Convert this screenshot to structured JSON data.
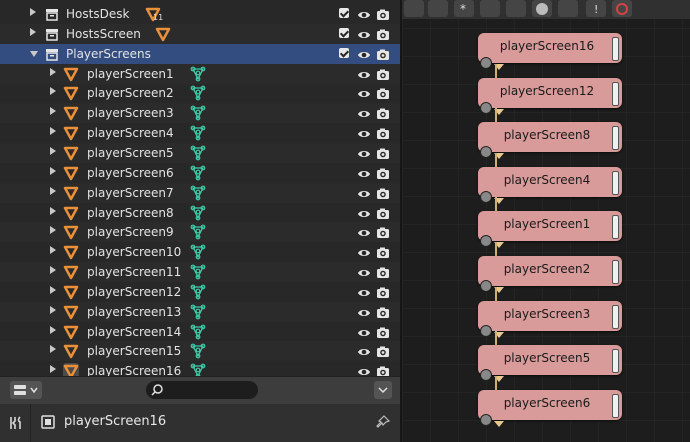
{
  "outliner": {
    "rows": [
      {
        "label": "HostsDesk",
        "kind": "collection",
        "expanded": false,
        "extra": "mesh-count",
        "extra_text": "11"
      },
      {
        "label": "HostsScreen",
        "kind": "collection",
        "expanded": false,
        "extra": "mesh"
      },
      {
        "label": "PlayerScreens",
        "kind": "collection",
        "expanded": true,
        "selected": true
      },
      {
        "label": "playerScreen1",
        "kind": "object"
      },
      {
        "label": "playerScreen2",
        "kind": "object"
      },
      {
        "label": "playerScreen3",
        "kind": "object"
      },
      {
        "label": "playerScreen4",
        "kind": "object"
      },
      {
        "label": "playerScreen5",
        "kind": "object"
      },
      {
        "label": "playerScreen6",
        "kind": "object"
      },
      {
        "label": "playerScreen7",
        "kind": "object"
      },
      {
        "label": "playerScreen8",
        "kind": "object"
      },
      {
        "label": "playerScreen9",
        "kind": "object"
      },
      {
        "label": "playerScreen10",
        "kind": "object"
      },
      {
        "label": "playerScreen11",
        "kind": "object"
      },
      {
        "label": "playerScreen12",
        "kind": "object"
      },
      {
        "label": "playerScreen13",
        "kind": "object"
      },
      {
        "label": "playerScreen14",
        "kind": "object"
      },
      {
        "label": "playerScreen15",
        "kind": "object"
      },
      {
        "label": "playerScreen16",
        "kind": "object",
        "active": true
      }
    ]
  },
  "search": {
    "placeholder": ""
  },
  "properties": {
    "object_name": "playerScreen16"
  },
  "node_editor": {
    "nodes": [
      "playerScreen16",
      "playerScreen12",
      "playerScreen8",
      "playerScreen4",
      "playerScreen1",
      "playerScreen2",
      "playerScreen3",
      "playerScreen5",
      "playerScreen6"
    ]
  },
  "colors": {
    "selected_row": "#334d80",
    "object_icon": "#e8903a",
    "mesh_icon": "#3ec9a7",
    "node_fill": "#d99a9a",
    "panel_bg": "#282828"
  }
}
